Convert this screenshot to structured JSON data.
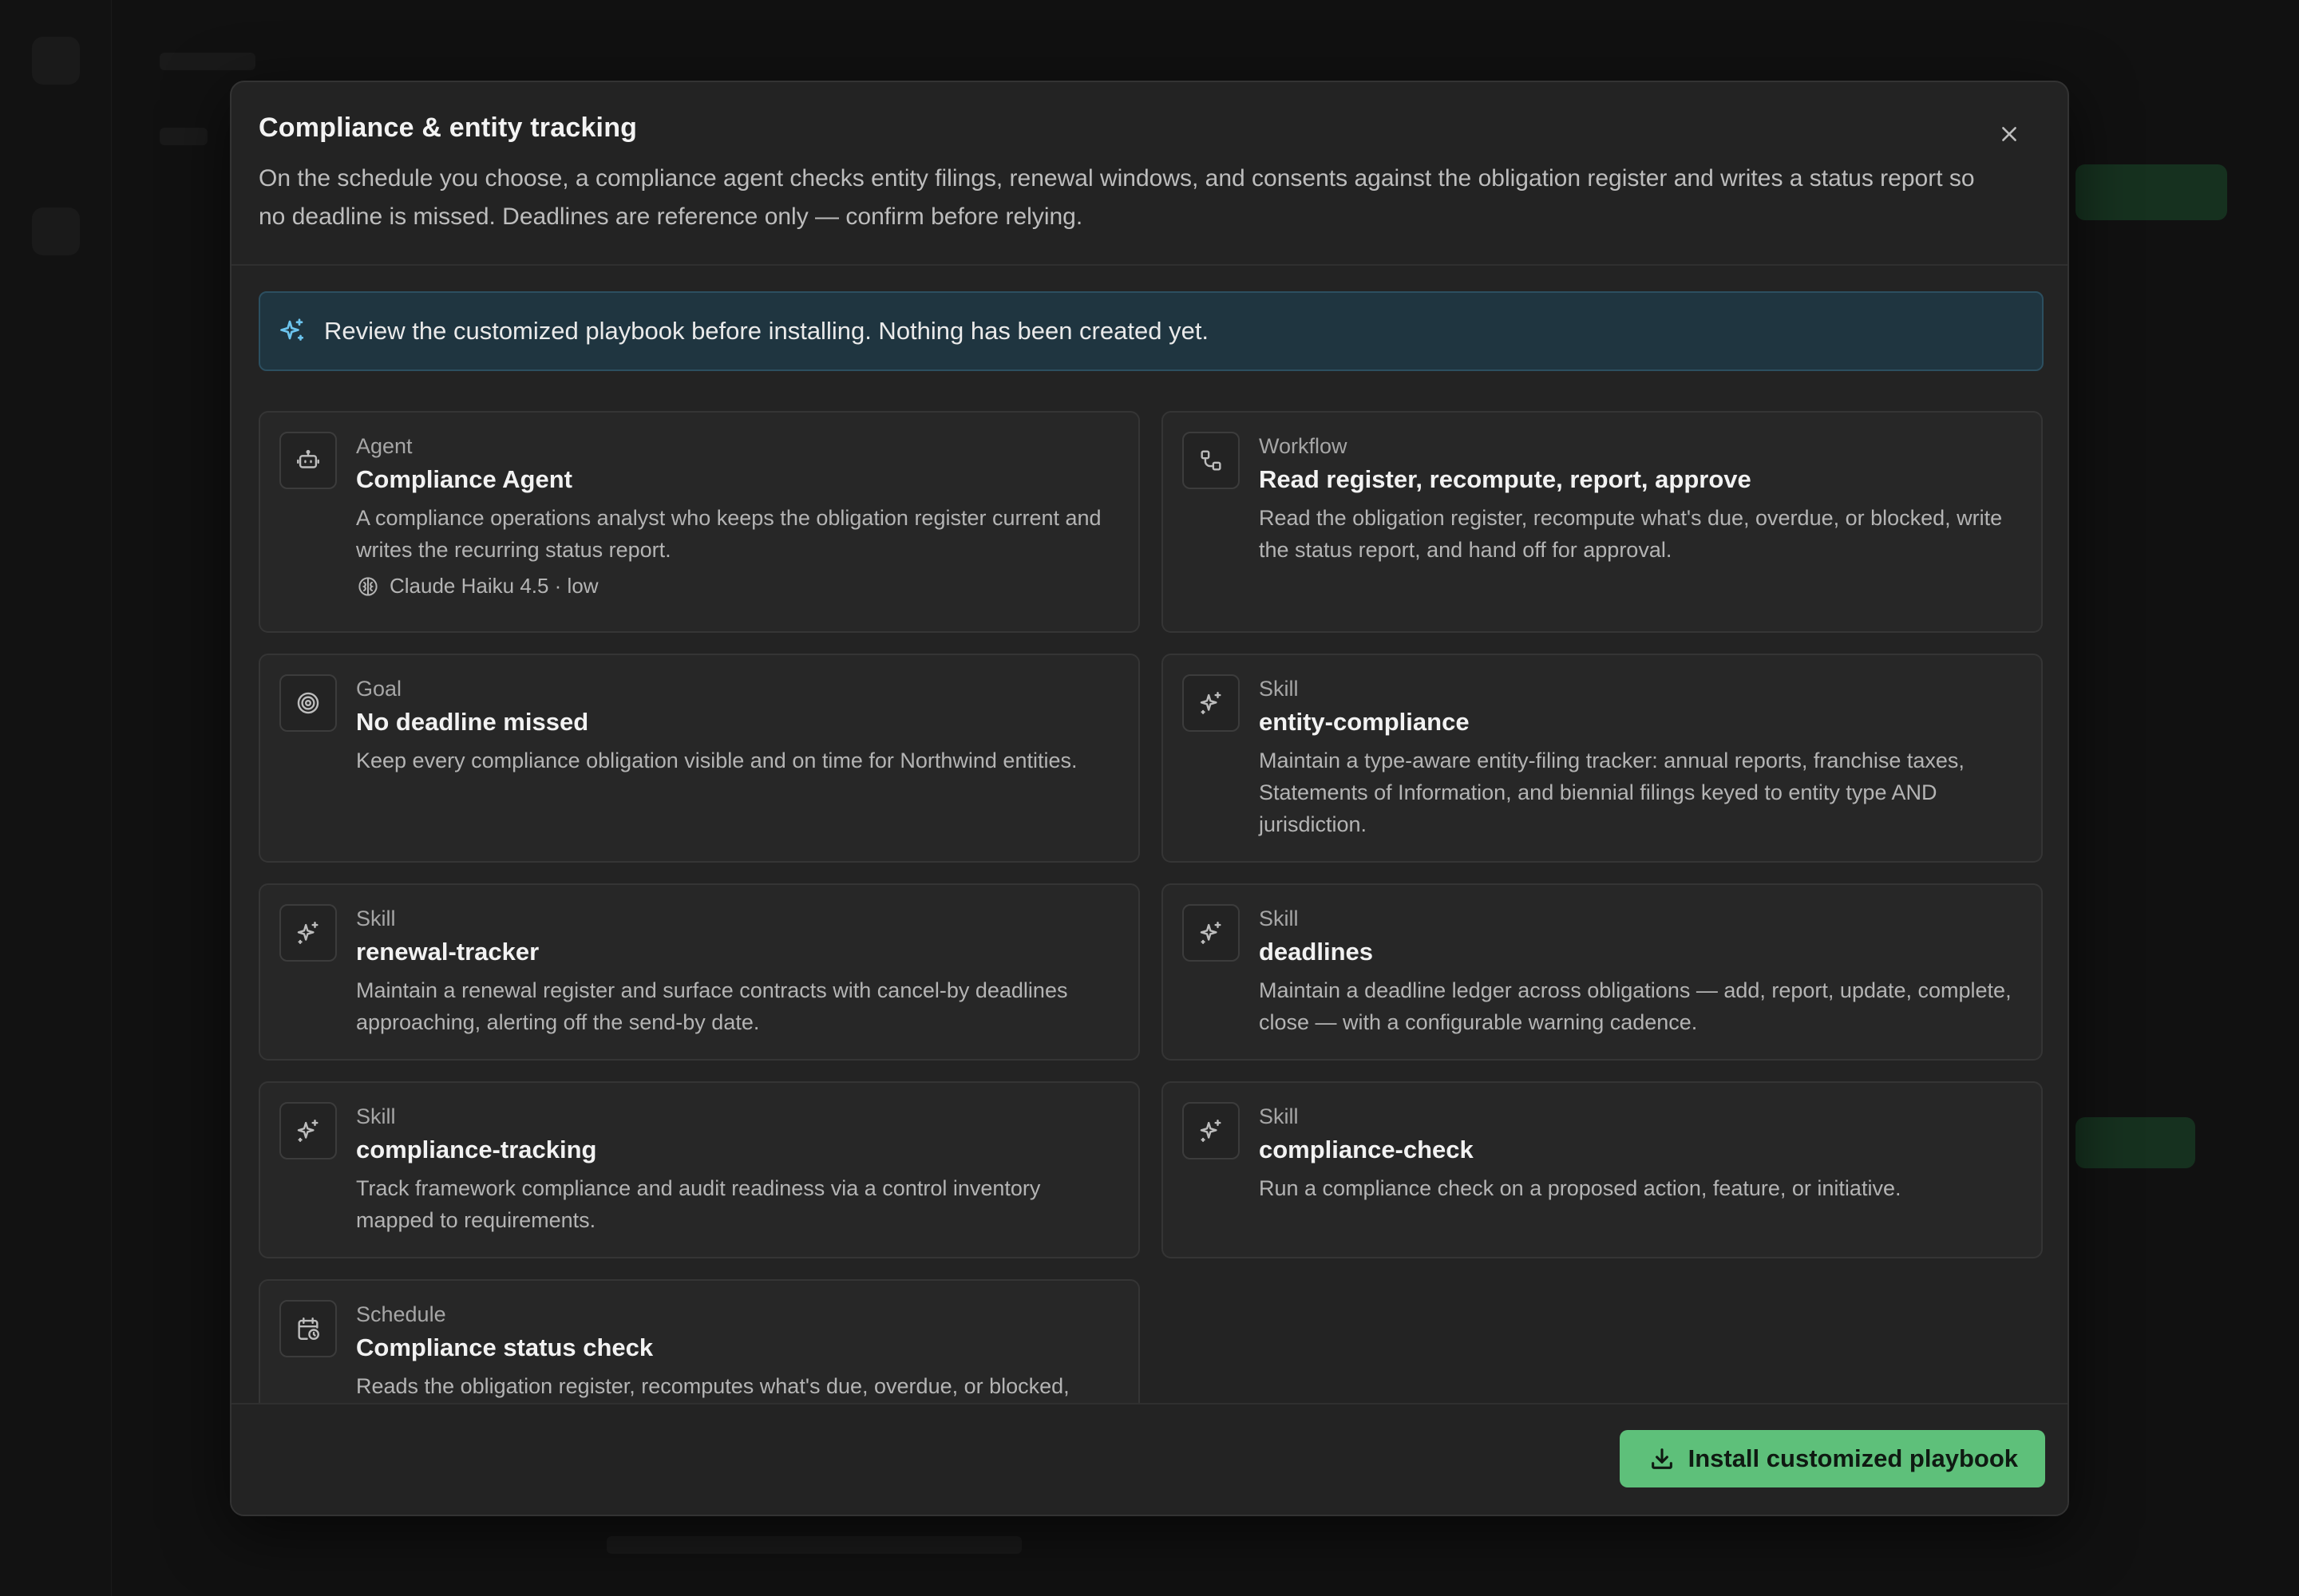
{
  "modal": {
    "title": "Compliance & entity tracking",
    "description": "On the schedule you choose, a compliance agent checks entity filings, renewal windows, and consents against the obligation register and writes a status report so no deadline is missed. Deadlines are reference only — confirm before relying.",
    "close_icon": "close-icon"
  },
  "notice": {
    "icon": "sparkles-icon",
    "text": "Review the customized playbook before installing. Nothing has been created yet."
  },
  "cards": [
    {
      "kind": "Agent",
      "title": "Compliance Agent",
      "description": "A compliance operations analyst who keeps the obligation register current and writes the recurring status report.",
      "icon": "robot-icon",
      "meta": "Claude Haiku 4.5 · low",
      "meta_icon": "brain-icon"
    },
    {
      "kind": "Workflow",
      "title": "Read register, recompute, report, approve",
      "description": "Read the obligation register, recompute what's due, overdue, or blocked, write the status report, and hand off for approval.",
      "icon": "workflow-icon"
    },
    {
      "kind": "Goal",
      "title": "No deadline missed",
      "description": "Keep every compliance obligation visible and on time for Northwind entities.",
      "icon": "target-icon"
    },
    {
      "kind": "Skill",
      "title": "entity-compliance",
      "description": "Maintain a type-aware entity-filing tracker: annual reports, franchise taxes, Statements of Information, and biennial filings keyed to entity type AND jurisdiction.",
      "icon": "sparkles-icon"
    },
    {
      "kind": "Skill",
      "title": "renewal-tracker",
      "description": "Maintain a renewal register and surface contracts with cancel-by deadlines approaching, alerting off the send-by date.",
      "icon": "sparkles-icon"
    },
    {
      "kind": "Skill",
      "title": "deadlines",
      "description": "Maintain a deadline ledger across obligations — add, report, update, complete, close — with a configurable warning cadence.",
      "icon": "sparkles-icon"
    },
    {
      "kind": "Skill",
      "title": "compliance-tracking",
      "description": "Track framework compliance and audit readiness via a control inventory mapped to requirements.",
      "icon": "sparkles-icon"
    },
    {
      "kind": "Skill",
      "title": "compliance-check",
      "description": "Run a compliance check on a proposed action, feature, or initiative.",
      "icon": "sparkles-icon"
    },
    {
      "kind": "Schedule",
      "title": "Compliance status check",
      "description": "Reads the obligation register, recomputes what's due, overdue, or blocked,",
      "icon": "calendar-clock-icon"
    }
  ],
  "footer": {
    "install_label": "Install customized playbook",
    "install_icon": "download-icon"
  },
  "colors": {
    "accent": "#5ec07a",
    "notice_bg": "#1f3540",
    "notice_border": "#2c4f60",
    "notice_icon": "#6cc4ee"
  }
}
